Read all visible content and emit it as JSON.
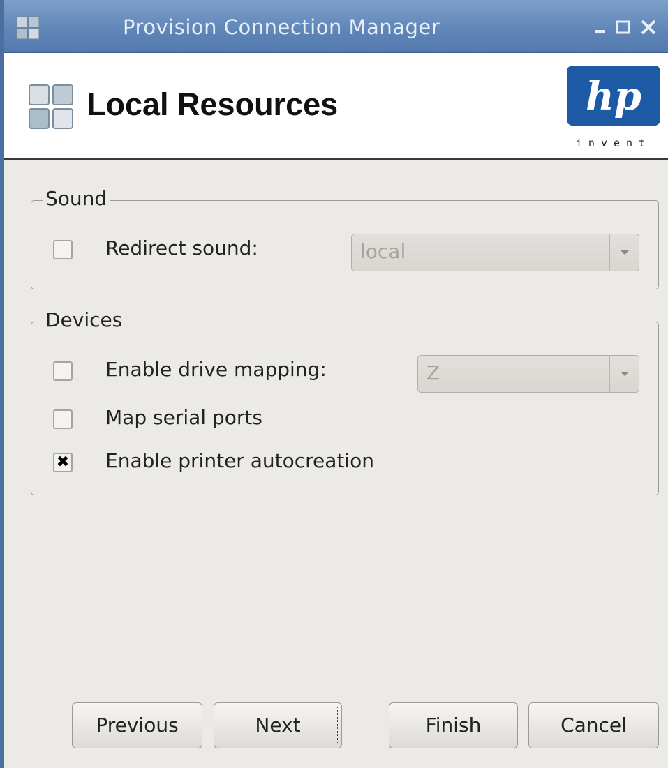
{
  "window": {
    "title": "Provision Connection Manager",
    "controls": [
      "minimize-icon",
      "maximize-icon",
      "close-icon"
    ]
  },
  "header": {
    "title": "Local Resources",
    "logo_text": "hp",
    "logo_tagline": "invent"
  },
  "sound": {
    "legend": "Sound",
    "redirect_label": "Redirect sound:",
    "redirect_checked": false,
    "redirect_value": "local"
  },
  "devices": {
    "legend": "Devices",
    "drive_mapping_label": "Enable drive mapping:",
    "drive_mapping_checked": false,
    "drive_value": "Z",
    "serial_label": "Map serial ports",
    "serial_checked": false,
    "printer_label": "Enable printer autocreation",
    "printer_checked": true
  },
  "buttons": {
    "previous": "Previous",
    "next": "Next",
    "finish": "Finish",
    "cancel": "Cancel"
  },
  "colors": {
    "titlebar": "#5f85b8",
    "hp_blue": "#1c5aa5"
  }
}
